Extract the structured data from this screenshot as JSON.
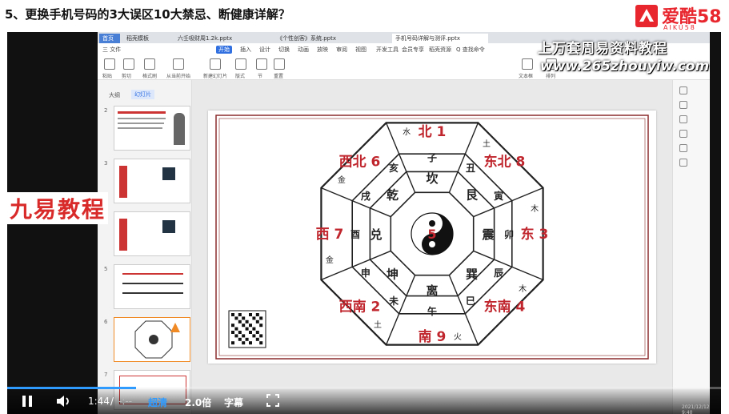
{
  "header": {
    "title": "5、更换手机号码的3大误区10大禁忌、断健康详解？",
    "brand_name": "爱酷58",
    "brand_sub": "AIKU58"
  },
  "browser_tabs": [
    "首页",
    "稻壳模板",
    "六壬吸财周1.2k.pptx",
    "《个性创客》系统.pptx",
    "手机号码详解与测评.pptx"
  ],
  "ribbon_menu": [
    "三 文件",
    "开始",
    "插入",
    "设计",
    "切换",
    "动画",
    "放映",
    "审阅",
    "视图",
    "开发工具",
    "会员专享",
    "稻壳资源",
    "Q 查找命令"
  ],
  "ribbon_tools": [
    "粘贴",
    "剪切",
    "格式刷",
    "从当前开始",
    "新建幻灯片",
    "版式",
    "节",
    "重置",
    "文本框",
    "排列"
  ],
  "thumb_tabs": {
    "outline": "大纲",
    "slides": "幻灯片"
  },
  "slide_numbers": [
    "2",
    "3",
    "4",
    "5",
    "6",
    "7"
  ],
  "watermarks": {
    "top": "上万套周易资料教程",
    "url": "www.265zhouyiw.com",
    "left": "九易教程"
  },
  "bagua": {
    "outer_labels": [
      "北 1",
      "东北 8",
      "东 3",
      "东南 4",
      "南 9",
      "西南 2",
      "西 7",
      "西北 6"
    ],
    "elements": [
      "水",
      "土",
      "木",
      "木",
      "火",
      "土",
      "金",
      "金"
    ],
    "trigrams": [
      "坎",
      "艮",
      "震",
      "巽",
      "离",
      "坤",
      "兑",
      "乾"
    ],
    "branches": [
      "子",
      "丑",
      "寅",
      "卯",
      "辰",
      "巳",
      "午",
      "未",
      "申",
      "酉",
      "戌",
      "亥"
    ],
    "center": "5"
  },
  "player": {
    "time_current": "1:44",
    "time_separator": "/",
    "time_total": "-:--",
    "quality": "超清",
    "speed": "2.0倍",
    "subtitles": "字幕",
    "progress": 0.18,
    "clock": "2021/12/12 9:40"
  }
}
